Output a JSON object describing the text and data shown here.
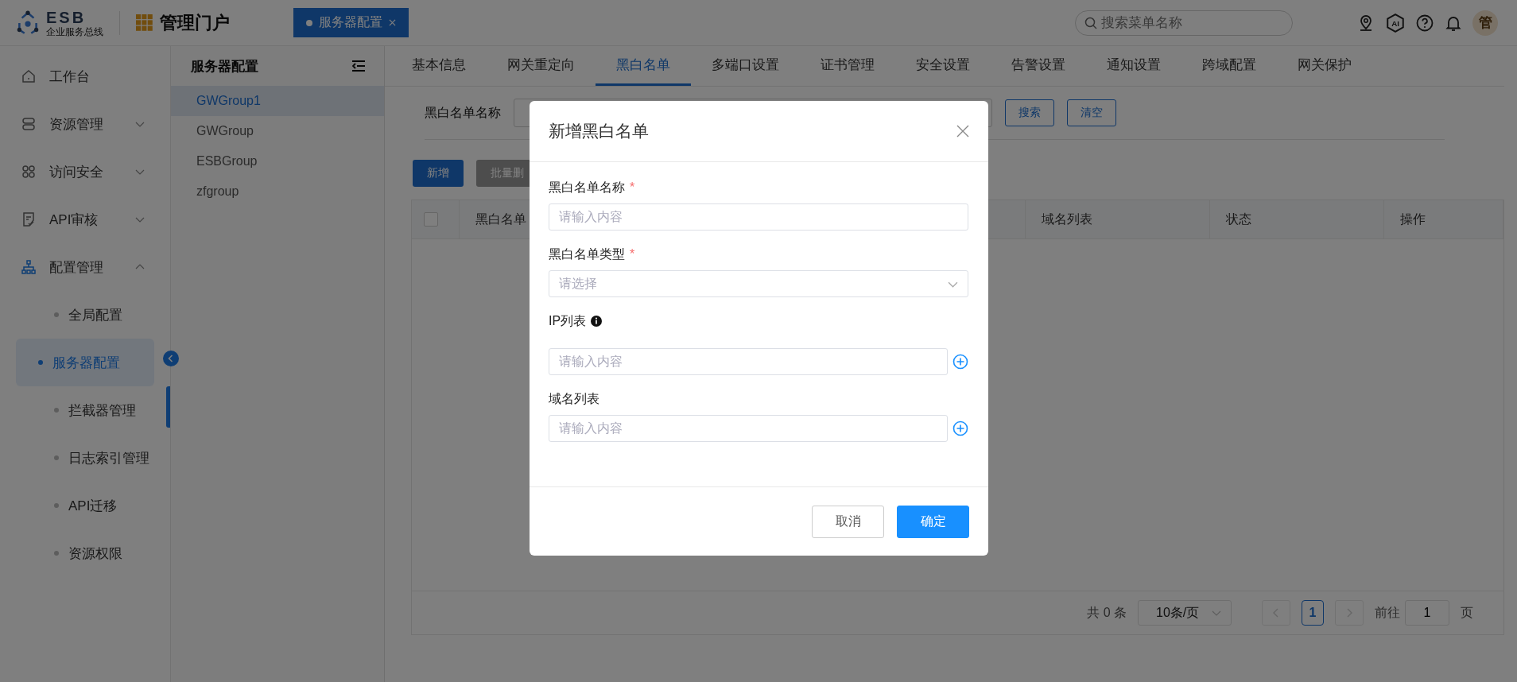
{
  "header": {
    "logo_title": "ESB",
    "logo_subtitle": "企业服务总线",
    "portal_title": "管理门户",
    "ai_label": "AI",
    "avatar": "管"
  },
  "open_tabs": [
    {
      "label": "服务器配置",
      "selected": true
    }
  ],
  "search": {
    "placeholder": "搜索菜单名称"
  },
  "sidebar": {
    "items": [
      {
        "label": "工作台",
        "kind": "link",
        "selected": false
      },
      {
        "label": "资源管理",
        "kind": "group",
        "expanded": false,
        "selected": false
      },
      {
        "label": "访问安全",
        "kind": "group",
        "expanded": false,
        "selected": false
      },
      {
        "label": "API审核",
        "kind": "group",
        "expanded": false,
        "selected": false
      },
      {
        "label": "配置管理",
        "kind": "group",
        "expanded": true,
        "selected": true,
        "children": [
          {
            "label": "全局配置",
            "selected": false
          },
          {
            "label": "服务器配置",
            "selected": true
          },
          {
            "label": "拦截器管理",
            "selected": false
          },
          {
            "label": "日志索引管理",
            "selected": false
          },
          {
            "label": "API迁移",
            "selected": false
          },
          {
            "label": "资源权限",
            "selected": false
          }
        ]
      }
    ]
  },
  "group_panel": {
    "title": "服务器配置",
    "items": [
      {
        "label": "GWGroup1",
        "selected": true
      },
      {
        "label": "GWGroup",
        "selected": false
      },
      {
        "label": "ESBGroup",
        "selected": false
      },
      {
        "label": "zfgroup",
        "selected": false
      }
    ]
  },
  "config_tabs": [
    {
      "label": "基本信息",
      "selected": false
    },
    {
      "label": "网关重定向",
      "selected": false
    },
    {
      "label": "黑白名单",
      "selected": true
    },
    {
      "label": "多端口设置",
      "selected": false
    },
    {
      "label": "证书管理",
      "selected": false
    },
    {
      "label": "安全设置",
      "selected": false
    },
    {
      "label": "告警设置",
      "selected": false
    },
    {
      "label": "通知设置",
      "selected": false
    },
    {
      "label": "跨域配置",
      "selected": false
    },
    {
      "label": "网关保护",
      "selected": false
    }
  ],
  "filter": {
    "label": "黑白名单名称",
    "buttons": [
      "搜索",
      "清空"
    ]
  },
  "actions": [
    {
      "label": "新增",
      "disabled": false
    },
    {
      "label": "批量删",
      "disabled": true
    }
  ],
  "table": {
    "select_all_checked": false,
    "columns": [
      "黑白名单",
      "域名列表",
      "状态",
      "操作"
    ]
  },
  "pagination": {
    "total": "共 0 条",
    "page_size": "10条/页",
    "pages": [
      {
        "label": "1",
        "selected": true
      }
    ],
    "goto_label": "前往",
    "goto_value": "1",
    "goto_suffix": "页"
  },
  "dialog": {
    "title": "新增黑白名单",
    "required_mark": "*",
    "fields": [
      {
        "label": "黑白名单名称",
        "kind": "input",
        "required": true,
        "info": false,
        "addable": false,
        "placeholder": "请输入内容"
      },
      {
        "label": "黑白名单类型",
        "kind": "select",
        "required": true,
        "info": false,
        "addable": false,
        "placeholder": "请选择"
      },
      {
        "label": "IP列表",
        "kind": "input",
        "required": false,
        "info": true,
        "addable": true,
        "placeholder": "请输入内容"
      },
      {
        "label": "域名列表",
        "kind": "input",
        "required": false,
        "info": false,
        "addable": true,
        "placeholder": "请输入内容"
      }
    ],
    "cancel": "取消",
    "confirm": "确定"
  }
}
